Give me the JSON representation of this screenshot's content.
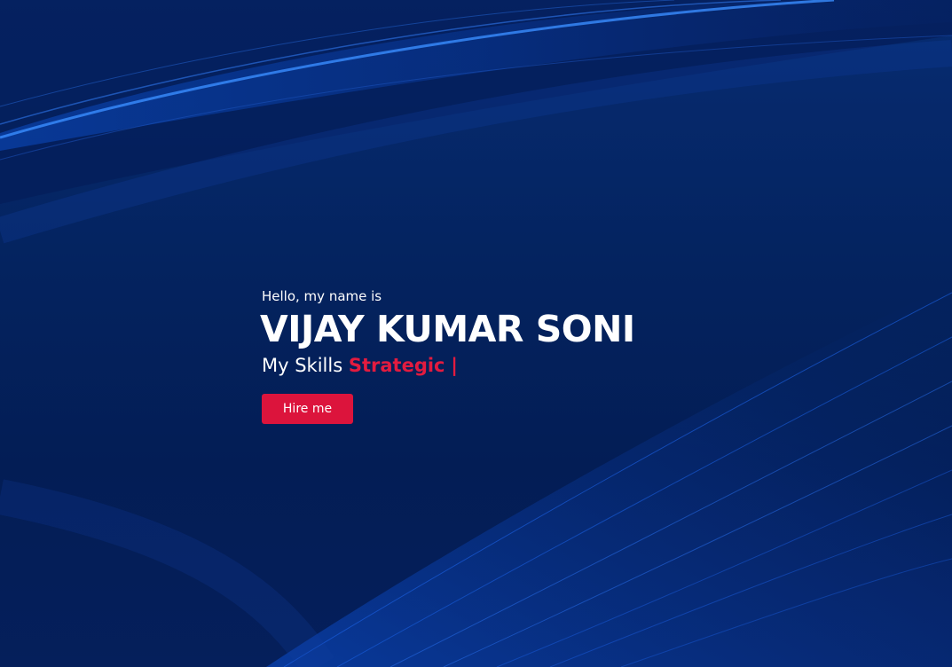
{
  "hero": {
    "greeting": "Hello, my name is",
    "name": "VIJAY KUMAR SONI",
    "skills_prefix": "My Skills",
    "skill_word": "Strategic",
    "cursor": "|",
    "hire_button_label": "Hire me"
  },
  "colors": {
    "background": "#062a6b",
    "accent": "#dc143c",
    "text": "#ffffff"
  }
}
